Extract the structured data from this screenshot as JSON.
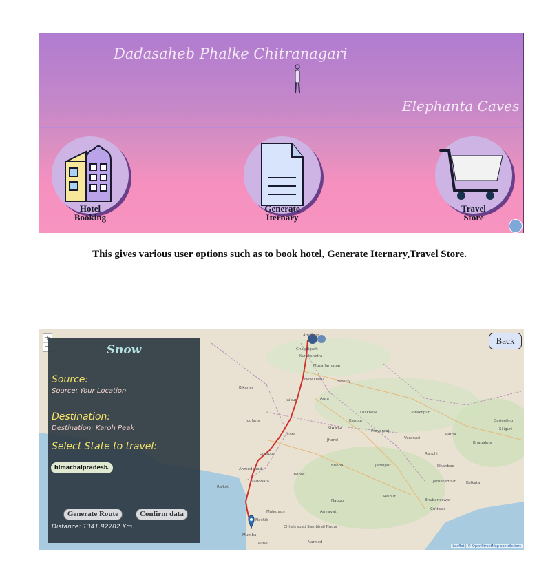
{
  "banner": {
    "place_left": "Dadasaheb Phalke Chitranagari",
    "place_right": "Elephanta Caves",
    "options": [
      {
        "line1": "Hotel",
        "line2": "Booking",
        "icon": "hotel-icon"
      },
      {
        "line1": "Generate",
        "line2": "Iternary",
        "icon": "document-icon"
      },
      {
        "line1": "Travel",
        "line2": "Store",
        "icon": "shopping-cart-icon"
      }
    ]
  },
  "caption": "This gives various user options such as to book hotel, Generate Iternary,Travel Store.",
  "map": {
    "zoom_in": "+",
    "zoom_out": "−",
    "back_label": "Back",
    "panel": {
      "title": "Snow",
      "source_label": "Source:",
      "source_value": "Source: Your Location",
      "destination_label": "Destination:",
      "destination_value": "Destination: Karoh Peak",
      "state_label": "Select State to travel:",
      "state_selected": "himachalpradesh",
      "generate_button": "Generate Route",
      "confirm_button": "Confirm data",
      "distance_text": "Distance: 1341.92782 Km"
    },
    "attribution": "Leaflet | © OpenStreetMap contributors",
    "labels": {
      "amritsar": "Amritsar",
      "chandigarh": "Chandigarh",
      "kurukshetra": "Kurukshetra",
      "muzaffarnagar": "Muzaffarnagar",
      "new_delhi": "New Delhi",
      "bareilly": "Bareilly",
      "agra": "Agra",
      "jaipur": "Jaipur",
      "bikaner": "Bikaner",
      "jodhpur": "Jodhpur",
      "lucknow": "Lucknow",
      "kanpur": "Kanpur",
      "gorakhpur": "Gorakhpur",
      "patna": "Patna",
      "varanasi": "Varanasi",
      "prayagraj": "Prayagraj",
      "gwalior": "Gwalior",
      "jhansi": "Jhansi",
      "kota": "Kota",
      "udaipur": "Udaipur",
      "ahmedabad": "Ahmedabad",
      "indore": "Indore",
      "bhopal": "Bhopal",
      "jabalpur": "Jabalpur",
      "vadodara": "Vadodara",
      "rajkot": "Rajkot",
      "nagpur": "Nagpur",
      "raipur": "Raipur",
      "ranchi": "Ranchi",
      "dhanbad": "Dhanbad",
      "kolkata": "Kolkata",
      "jamshedpur": "Jamshedpur",
      "bhubaneswar": "Bhubaneswar",
      "cuttack": "Cuttack",
      "malegaon": "Malegaon",
      "nashik": "Nashik",
      "mumbai": "Mumbai",
      "pune": "Pune",
      "amravati": "Amravati",
      "nanded": "Nanded",
      "bhagalpur": "Bhagalpur",
      "darjeeling": "Darjeeling",
      "siliguri": "Siliguri",
      "aurangabad": "Chhatrapati Sambhaji Nagar"
    },
    "route_color": "#d0312d",
    "marker_color": "#2a6fb3"
  }
}
